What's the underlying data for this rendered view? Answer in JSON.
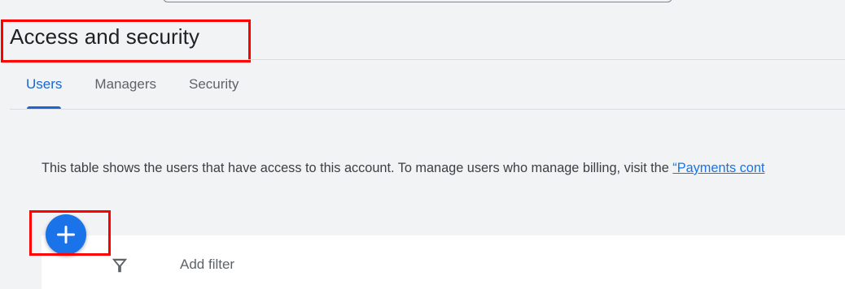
{
  "page": {
    "title": "Access and security"
  },
  "tabs": [
    {
      "label": "Users",
      "active": true
    },
    {
      "label": "Managers",
      "active": false
    },
    {
      "label": "Security",
      "active": false
    }
  ],
  "info": {
    "text": "This table shows the users that have access to this account. To manage users who manage billing, visit the ",
    "link": "“Payments cont"
  },
  "fab": {
    "icon": "plus-icon",
    "color": "#1a73e8"
  },
  "filter": {
    "icon": "filter-icon",
    "label": "Add filter"
  },
  "colors": {
    "accent": "#1967d2",
    "highlight": "#ff0000",
    "background": "#f1f3f4"
  }
}
